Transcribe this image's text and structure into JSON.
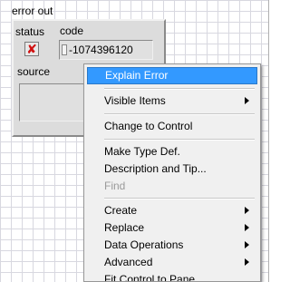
{
  "cluster": {
    "label": "error out",
    "status_label": "status",
    "code_label": "code",
    "source_label": "source",
    "code_value": "-1074396120",
    "status_icon": "x-icon",
    "status_color": "#d01010"
  },
  "menu": {
    "highlight_color": "#3399ff",
    "items": [
      {
        "label": "Explain Error"
      },
      {
        "label": "Visible Items"
      },
      {
        "label": "Change to Control"
      },
      {
        "label": "Make Type Def."
      },
      {
        "label": "Description and Tip..."
      },
      {
        "label": "Find"
      },
      {
        "label": "Create"
      },
      {
        "label": "Replace"
      },
      {
        "label": "Data Operations"
      },
      {
        "label": "Advanced"
      },
      {
        "label": "Fit Control to Pane"
      }
    ]
  }
}
